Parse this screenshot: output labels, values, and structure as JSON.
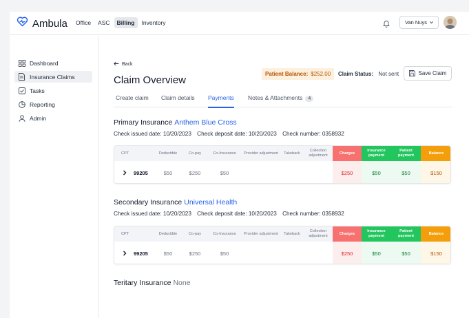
{
  "app": {
    "name": "Ambula",
    "nav": [
      "Office",
      "ASC",
      "Billing",
      "Inventory"
    ],
    "active_nav": "Billing",
    "location": "Van Nuys"
  },
  "sidebar": {
    "items": [
      {
        "label": "Dashboard",
        "icon": "grid-icon"
      },
      {
        "label": "Insurance Claims",
        "icon": "document-icon"
      },
      {
        "label": "Tasks",
        "icon": "checkbox-icon"
      },
      {
        "label": "Reporting",
        "icon": "pie-chart-icon"
      },
      {
        "label": "Admin",
        "icon": "user-icon"
      }
    ],
    "active": "Insurance Claims"
  },
  "header": {
    "back_label": "Back",
    "title": "Claim Overview",
    "patient_balance_label": "Patient Balance:",
    "patient_balance_value": "$252.00",
    "claim_status_label": "Claim Status:",
    "claim_status_value": "Not sent",
    "save_label": "Save Claim"
  },
  "tabs": [
    {
      "label": "Create claim"
    },
    {
      "label": "Claim details"
    },
    {
      "label": "Payments",
      "active": true
    },
    {
      "label": "Notes & Attachments",
      "count": "4"
    }
  ],
  "colors": {
    "charges": "#f87171",
    "insurance_payment": "#22c55e",
    "patient_payment": "#22c55e",
    "balance": "#f59e0b",
    "accent": "#2563eb"
  },
  "table_headers": [
    "CPT",
    "Deductible",
    "Co-pay",
    "Co-Insurance",
    "Provider adjustment",
    "Takeback",
    "Collection adjustment",
    "Charges",
    "Insurance payment",
    "Patient payment",
    "Balance"
  ],
  "primary": {
    "label": "Primary Insurance",
    "carrier": "Anthem Blue Cross",
    "check_issued": "Check issued date: 10/20/2023",
    "check_deposit": "Check deposit date: 10/20/2023",
    "check_number": "Check number: 0358932",
    "row": {
      "cpt": "99205",
      "deductible": "$50",
      "copay": "$250",
      "coinsurance": "$50",
      "provider_adjustment": "",
      "takeback": "",
      "collection_adjustment": "",
      "charges": "$250",
      "insurance_payment": "$50",
      "patient_payment": "$50",
      "balance": "$150"
    }
  },
  "secondary": {
    "label": "Secondary Insurance",
    "carrier": "Universal Health",
    "check_issued": "Check issued date: 10/20/2023",
    "check_deposit": "Check deposit date: 10/20/2023",
    "check_number": "Check number: 0358932",
    "row": {
      "cpt": "99205",
      "deductible": "$50",
      "copay": "$250",
      "coinsurance": "$50",
      "provider_adjustment": "",
      "takeback": "",
      "collection_adjustment": "",
      "charges": "$250",
      "insurance_payment": "$50",
      "patient_payment": "$50",
      "balance": "$150"
    }
  },
  "tertiary": {
    "label": "Teritary Insurance",
    "carrier": "None"
  }
}
